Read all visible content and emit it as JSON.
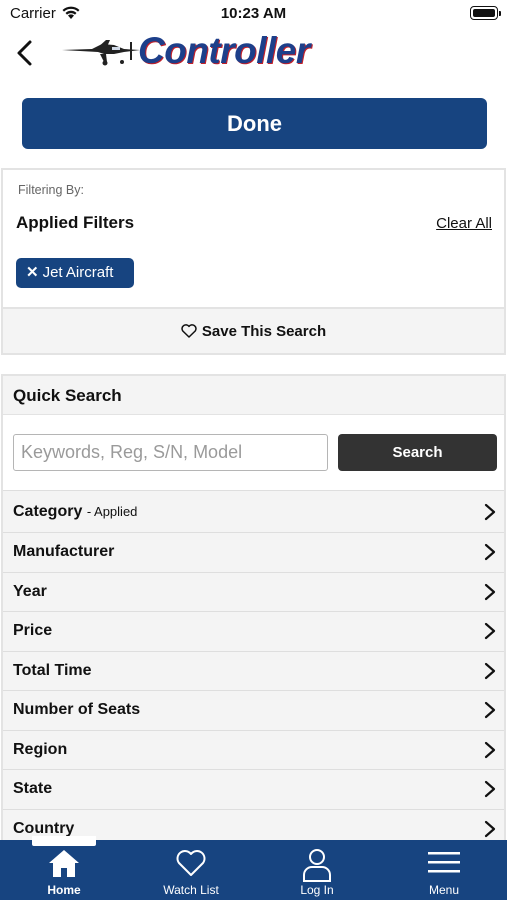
{
  "status_bar": {
    "carrier": "Carrier",
    "time": "10:23 AM"
  },
  "header": {
    "logo_text": "Controller"
  },
  "done_button": {
    "label": "Done"
  },
  "filters": {
    "filtering_by": "Filtering By:",
    "title": "Applied Filters",
    "clear_all": "Clear All",
    "chips": [
      {
        "label": "Jet Aircraft"
      }
    ],
    "save_search": "Save This Search"
  },
  "quick_search": {
    "title": "Quick Search",
    "placeholder": "Keywords, Reg, S/N, Model",
    "value": "",
    "search_label": "Search"
  },
  "filter_list": [
    {
      "label": "Category",
      "note": "- Applied"
    },
    {
      "label": "Manufacturer"
    },
    {
      "label": "Year"
    },
    {
      "label": "Price"
    },
    {
      "label": "Total Time"
    },
    {
      "label": "Number of Seats"
    },
    {
      "label": "Region"
    },
    {
      "label": "State"
    },
    {
      "label": "Country"
    }
  ],
  "tab_bar": {
    "tabs": [
      {
        "label": "Home",
        "icon": "home-icon",
        "selected": true
      },
      {
        "label": "Watch List",
        "icon": "heart-icon"
      },
      {
        "label": "Log In",
        "icon": "user-icon"
      },
      {
        "label": "Menu",
        "icon": "hamburger-icon"
      }
    ]
  },
  "colors": {
    "brand_blue": "#174480",
    "search_button": "#333333",
    "panel_gray": "#f4f4f4",
    "logo_red": "#c0202a"
  }
}
